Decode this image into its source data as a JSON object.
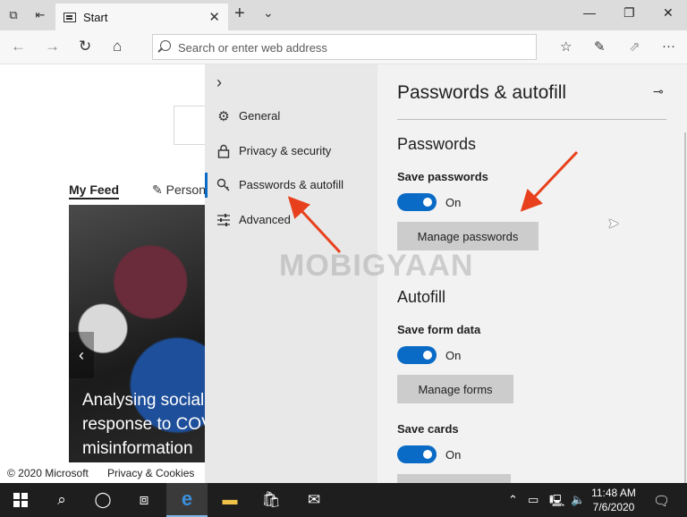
{
  "browser": {
    "tab_title": "Start",
    "address_placeholder": "Search or enter web address"
  },
  "page": {
    "feed_tab": "My Feed",
    "personalize_tab": "Person",
    "news_caption_lines": [
      "Analysing social",
      "response to COV",
      "misinformation"
    ],
    "footer_copyright": "© 2020 Microsoft",
    "footer_privacy": "Privacy & Cookies"
  },
  "settings_nav": {
    "items": [
      {
        "label": "General",
        "icon": "gear-icon"
      },
      {
        "label": "Privacy & security",
        "icon": "lock-icon"
      },
      {
        "label": "Passwords & autofill",
        "icon": "key-icon"
      },
      {
        "label": "Advanced",
        "icon": "sliders-icon"
      }
    ]
  },
  "settings_main": {
    "title": "Passwords & autofill",
    "passwords_heading": "Passwords",
    "save_passwords_label": "Save passwords",
    "save_passwords_state": "On",
    "manage_passwords_button": "Manage passwords",
    "autofill_heading": "Autofill",
    "save_form_data_label": "Save form data",
    "save_form_data_state": "On",
    "manage_forms_button": "Manage forms",
    "save_cards_label": "Save cards",
    "save_cards_state": "On"
  },
  "watermark": "MOBIGYAAN",
  "taskbar": {
    "time": "11:48 AM",
    "date": "7/6/2020"
  },
  "colors": {
    "accent": "#0a6bc6",
    "arrow": "#e8401c"
  }
}
